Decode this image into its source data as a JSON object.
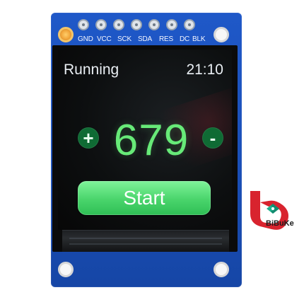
{
  "board": {
    "pin_labels": [
      "GND",
      "VCC",
      "SCK",
      "SDA",
      "RES",
      "DC",
      "BLK"
    ]
  },
  "screen": {
    "status_left": "Running",
    "status_right": "21:10",
    "plus_label": "+",
    "minus_label": "-",
    "count_value": "679",
    "start_label": "Start"
  },
  "brand": {
    "logo_text": "BiBuKe"
  },
  "colors": {
    "pcb_blue": "#1a4fb7",
    "count_green": "#67ea78",
    "button_green": "#49d46b",
    "dark_green": "#0f6b34",
    "logo_red": "#d71f2a"
  }
}
